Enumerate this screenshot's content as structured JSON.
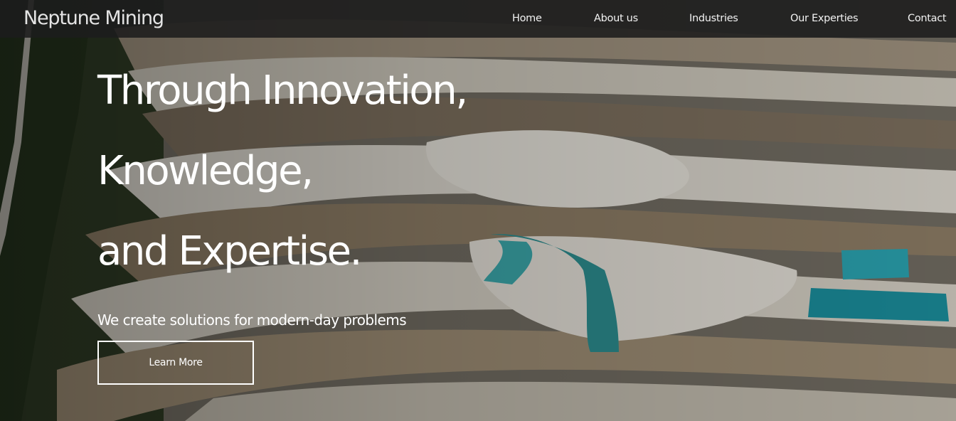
{
  "brand": {
    "name": "Neptune Mining"
  },
  "nav": {
    "items": [
      {
        "label": "Home"
      },
      {
        "label": "About us"
      },
      {
        "label": "Industries"
      },
      {
        "label": "Our Experties"
      },
      {
        "label": "Contact"
      }
    ]
  },
  "hero": {
    "headline_lines": [
      "Through Innovation,",
      "Knowledge,",
      "and Expertise."
    ],
    "subheading": "We create solutions for modern-day problems",
    "cta_label": "Learn More"
  },
  "colors": {
    "navbar_bg": "#1c1c1c",
    "text": "#ffffff",
    "water_teal": "#1a8a98"
  }
}
